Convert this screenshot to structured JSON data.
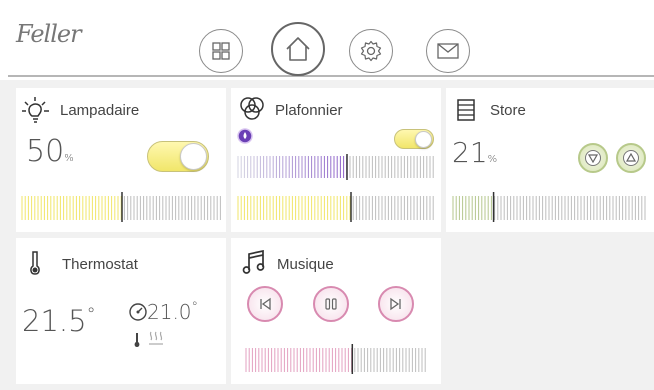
{
  "header": {
    "logo_text": "Feller",
    "nav": [
      {
        "name": "grid-icon"
      },
      {
        "name": "home-icon"
      },
      {
        "name": "gear-icon"
      },
      {
        "name": "mail-icon"
      }
    ]
  },
  "cards": {
    "lampadaire": {
      "title": "Lampadaire",
      "value": "50",
      "unit": "%",
      "on": true,
      "level": 0.5
    },
    "plafonnier": {
      "title": "Plafonnier",
      "on": true,
      "color_level": 0.55,
      "level": 0.57
    },
    "store": {
      "title": "Store",
      "value": "21",
      "unit": "%",
      "level": 0.21
    },
    "thermostat": {
      "title": "Thermostat",
      "current": "21.5",
      "current_unit": "°",
      "setpoint": "21.0",
      "setpoint_unit": "°",
      "heating": true
    },
    "musique": {
      "title": "Musique",
      "volume": 0.58
    }
  },
  "colors": {
    "yellow": "#f1e66a",
    "purple": "#9d7cd0",
    "green": "#b5c78e",
    "pink": "#e3a0c0"
  }
}
